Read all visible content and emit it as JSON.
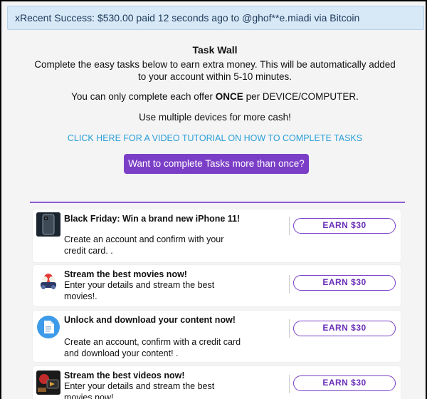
{
  "banner": {
    "text": "xRecent Success: $530.00 paid 12 seconds ago to @ghof**e.miadi via Bitcoin"
  },
  "header": {
    "title": "Task Wall",
    "intro": "Complete the easy tasks below to earn extra money. This will be automatically added to your account within 5-10 minutes.",
    "once_prefix": "You can only complete each offer ",
    "once_bold": "ONCE",
    "once_suffix": " per DEVICE/COMPUTER.",
    "multiple": "Use multiple devices for more cash!",
    "tutorial_link": "CLICK HERE FOR A VIDEO TUTORIAL ON HOW TO COMPLETE TASKS",
    "cta_button": "Want to complete Tasks more than once?"
  },
  "offers": [
    {
      "title": "Black Friday: Win a brand new iPhone 11!",
      "description": "Create an account and confirm with your credit card. .",
      "button": "EARN $30",
      "icon": "iphone-icon"
    },
    {
      "title": "Stream the best movies now!",
      "description": "Enter your details and stream the best movies!.",
      "button": "EARN $30",
      "icon": "popcorn-icon"
    },
    {
      "title": "Unlock and download your content now!",
      "description": "Create an account, confirm with a credit card and download your content! .",
      "button": "EARN $30",
      "icon": "file-icon"
    },
    {
      "title": "Stream the best videos now!",
      "description": "Enter your details and stream the best movies now!",
      "button": "EARN $30",
      "icon": "film-icon"
    }
  ],
  "colors": {
    "accent": "#7b3fc7",
    "link": "#2a9fd6",
    "banner_bg": "#d7e8f7"
  }
}
